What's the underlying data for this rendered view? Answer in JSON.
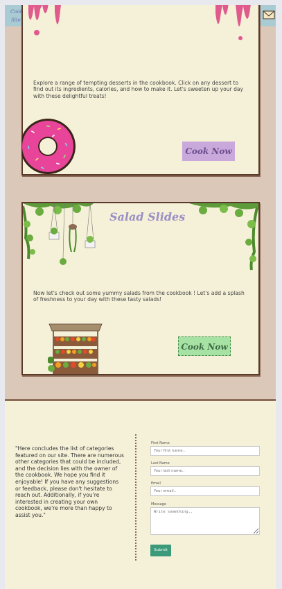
{
  "header": {
    "logo_line1": "Cooking",
    "logo_line2": "Site",
    "nav_icons": [
      "recipe-book-icon",
      "pot-icon",
      "chef-icon",
      "bowl-icon",
      "mail-icon"
    ]
  },
  "dessert_card": {
    "text": "Explore a range of tempting desserts in the cookbook. Click on any dessert to find out its ingredients, calories, and how to make it. Let's sweeten up your day with these delightful treats!",
    "button": "Cook Now",
    "button_color": "#c9a8dc"
  },
  "salad_card": {
    "title": "Salad Slides",
    "text": "Now let's check out some yummy salads from the cookbook ! Let's add a splash of freshness to your day with these tasty salads!",
    "button": "Cook Now",
    "button_color": "#a7e2a5"
  },
  "footer": {
    "quote": "\"Here concludes the list of categories featured on our site. There are numerous other categories that could be included, and the decision lies with the owner of the cookbook. We hope you find it enjoyable! If you have any suggestions or feedback, please don't hesitate to reach out. Additionally, if you're interested in creating your own cookbook, we're more than happy to assist you.\"",
    "form": {
      "first_name_label": "First Name",
      "first_name_placeholder": "Your first name..",
      "last_name_label": "Last Name",
      "last_name_placeholder": "Your last name..",
      "email_label": "Email",
      "email_placeholder": "Your email..",
      "message_label": "Message",
      "message_placeholder": "Write something..",
      "submit": "Submit"
    }
  }
}
